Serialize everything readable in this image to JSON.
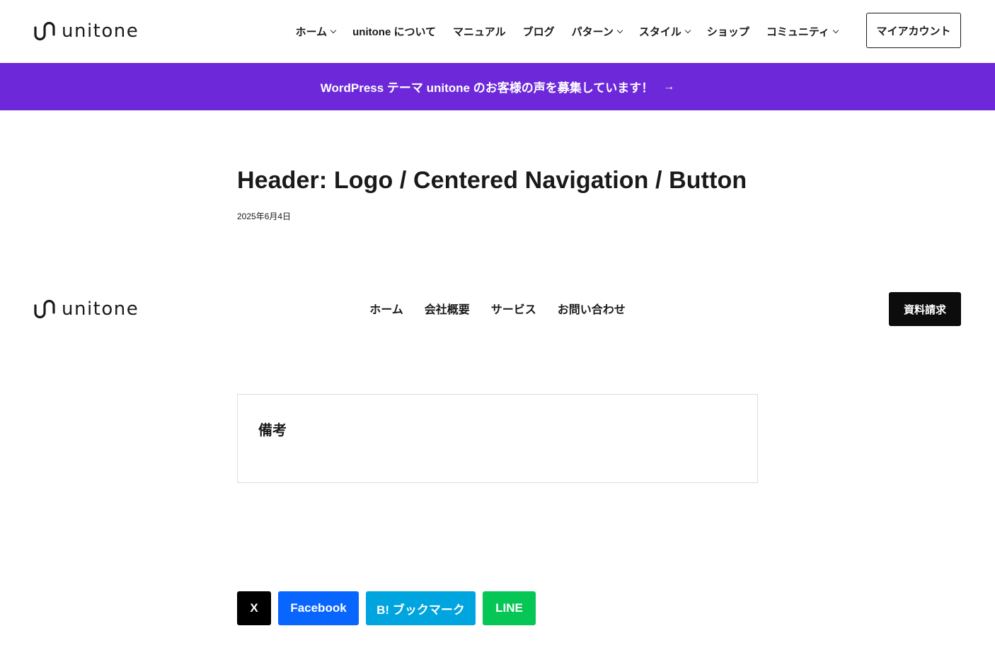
{
  "site": {
    "logo_text": "unitone",
    "nav": [
      {
        "label": "ホーム",
        "has_dropdown": true
      },
      {
        "label": "unitone について",
        "has_dropdown": false
      },
      {
        "label": "マニュアル",
        "has_dropdown": false
      },
      {
        "label": "ブログ",
        "has_dropdown": false
      },
      {
        "label": "パターン",
        "has_dropdown": true
      },
      {
        "label": "スタイル",
        "has_dropdown": true
      },
      {
        "label": "ショップ",
        "has_dropdown": false
      },
      {
        "label": "コミュニティ",
        "has_dropdown": true
      }
    ],
    "account_button": "マイアカウント"
  },
  "announcement": {
    "text": "WordPress テーマ unitone のお客様の声を募集しています！",
    "arrow": "→",
    "background_color": "#6d29d9"
  },
  "article": {
    "title": "Header: Logo / Centered Navigation / Button",
    "date": "2025年6月4日"
  },
  "preview_header": {
    "logo_text": "unitone",
    "nav": [
      "ホーム",
      "会社概要",
      "サービス",
      "お問い合わせ"
    ],
    "button": "資料請求"
  },
  "notes": {
    "title": "備考"
  },
  "share": [
    {
      "label": "X",
      "color": "#000000"
    },
    {
      "label": "Facebook",
      "color": "#0866ff"
    },
    {
      "label": "B! ブックマーク",
      "color": "#00a4de"
    },
    {
      "label": "LINE",
      "color": "#06c755"
    }
  ]
}
